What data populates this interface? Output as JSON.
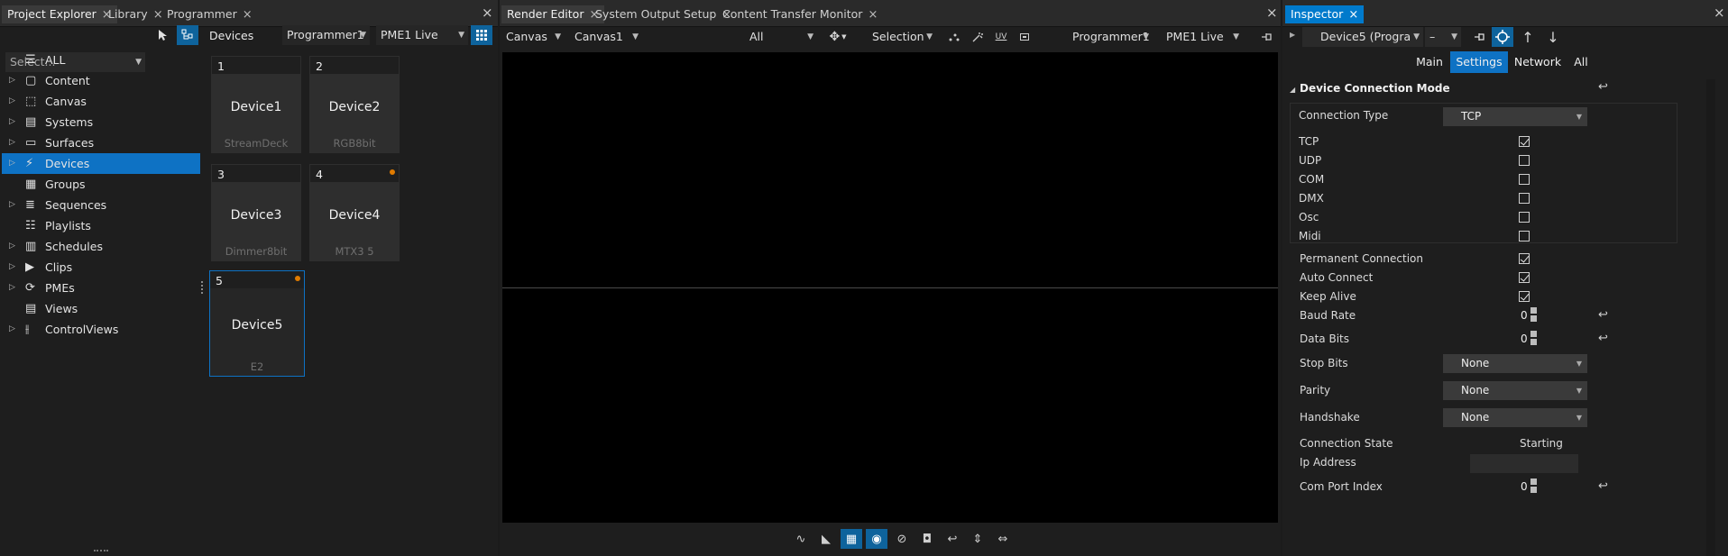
{
  "left_panel": {
    "tabs": [
      {
        "label": "Project Explorer"
      },
      {
        "label": "Library"
      },
      {
        "label": "Programmer"
      }
    ],
    "close_glyph": "×",
    "select_placeholder": "Select...",
    "tree": [
      {
        "label": "ALL",
        "icon": "database-icon",
        "expandable": false,
        "selected": false
      },
      {
        "label": "Content",
        "icon": "content-icon",
        "expandable": true,
        "selected": false
      },
      {
        "label": "Canvas",
        "icon": "canvas-icon",
        "expandable": true,
        "selected": false
      },
      {
        "label": "Systems",
        "icon": "systems-icon",
        "expandable": true,
        "selected": false
      },
      {
        "label": "Surfaces",
        "icon": "surfaces-icon",
        "expandable": true,
        "selected": false
      },
      {
        "label": "Devices",
        "icon": "plug-icon",
        "expandable": true,
        "selected": true
      },
      {
        "label": "Groups",
        "icon": "groups-icon",
        "expandable": false,
        "selected": false
      },
      {
        "label": "Sequences",
        "icon": "sequences-icon",
        "expandable": true,
        "selected": false
      },
      {
        "label": "Playlists",
        "icon": "playlist-icon",
        "expandable": false,
        "selected": false
      },
      {
        "label": "Schedules",
        "icon": "calendar-icon",
        "expandable": true,
        "selected": false
      },
      {
        "label": "Clips",
        "icon": "clip-icon",
        "expandable": true,
        "selected": false
      },
      {
        "label": "PMEs",
        "icon": "pme-icon",
        "expandable": true,
        "selected": false
      },
      {
        "label": "Views",
        "icon": "views-icon",
        "expandable": false,
        "selected": false
      },
      {
        "label": "ControlViews",
        "icon": "sliders-icon",
        "expandable": true,
        "selected": false
      }
    ],
    "devices_header": {
      "title": "Devices",
      "programmer": "Programmer1",
      "pme": "PME1 Live"
    },
    "devices": [
      {
        "num": "1",
        "name": "Device1",
        "type": "StreamDeck",
        "dot": false,
        "selected": false
      },
      {
        "num": "2",
        "name": "Device2",
        "type": "RGB8bit",
        "dot": false,
        "selected": false
      },
      {
        "num": "3",
        "name": "Device3",
        "type": "Dimmer8bit",
        "dot": false,
        "selected": false
      },
      {
        "num": "4",
        "name": "Device4",
        "type": "MTX3 5",
        "dot": true,
        "selected": false
      },
      {
        "num": "5",
        "name": "Device5",
        "type": "E2",
        "dot": true,
        "selected": true
      }
    ],
    "accent_color": "#0e72c4",
    "status_dot_color": "#e07b00"
  },
  "center_panel": {
    "tabs": [
      {
        "label": "Render Editor"
      },
      {
        "label": "System Output Setup"
      },
      {
        "label": "Content Transfer Monitor"
      }
    ],
    "toolbar": {
      "canvas_type": "Canvas",
      "canvas_name": "Canvas1",
      "filter": "All",
      "mode": "Selection",
      "uv_label": "UV",
      "programmer": "Programmer1",
      "pme": "PME1 Live"
    },
    "bottom_tools": [
      "waveform-icon",
      "ruler-icon",
      "grid-icon",
      "camera-move-icon",
      "rotate-off-icon",
      "snapshot-icon",
      "undo-icon",
      "fit-height-icon",
      "fit-width-icon"
    ]
  },
  "inspector": {
    "tab": "Inspector",
    "object": "Device5 (Progra",
    "object_arrow": "–",
    "subtabs": [
      {
        "label": "Main",
        "active": false
      },
      {
        "label": "Settings",
        "active": true
      },
      {
        "label": "Network",
        "active": false
      },
      {
        "label": "All",
        "active": false
      }
    ],
    "section_title": "Device Connection Mode",
    "connection_type_label": "Connection Type",
    "connection_type_value": "TCP",
    "protocols": [
      {
        "label": "TCP",
        "checked": true
      },
      {
        "label": "UDP",
        "checked": false
      },
      {
        "label": "COM",
        "checked": false
      },
      {
        "label": "DMX",
        "checked": false
      },
      {
        "label": "Osc",
        "checked": false
      },
      {
        "label": "Midi",
        "checked": false
      }
    ],
    "options": [
      {
        "label": "Permanent Connection",
        "checked": true
      },
      {
        "label": "Auto Connect",
        "checked": true
      },
      {
        "label": "Keep Alive",
        "checked": true
      }
    ],
    "baud_rate": {
      "label": "Baud Rate",
      "value": "0"
    },
    "data_bits": {
      "label": "Data Bits",
      "value": "0"
    },
    "stop_bits": {
      "label": "Stop Bits",
      "value": "None"
    },
    "parity": {
      "label": "Parity",
      "value": "None"
    },
    "handshake": {
      "label": "Handshake",
      "value": "None"
    },
    "connection_state": {
      "label": "Connection State",
      "value": "Starting"
    },
    "ip_address": {
      "label": "Ip Address",
      "value": ""
    },
    "com_port_index": {
      "label": "Com Port Index",
      "value": "0"
    },
    "tab_color": "#007acc"
  }
}
